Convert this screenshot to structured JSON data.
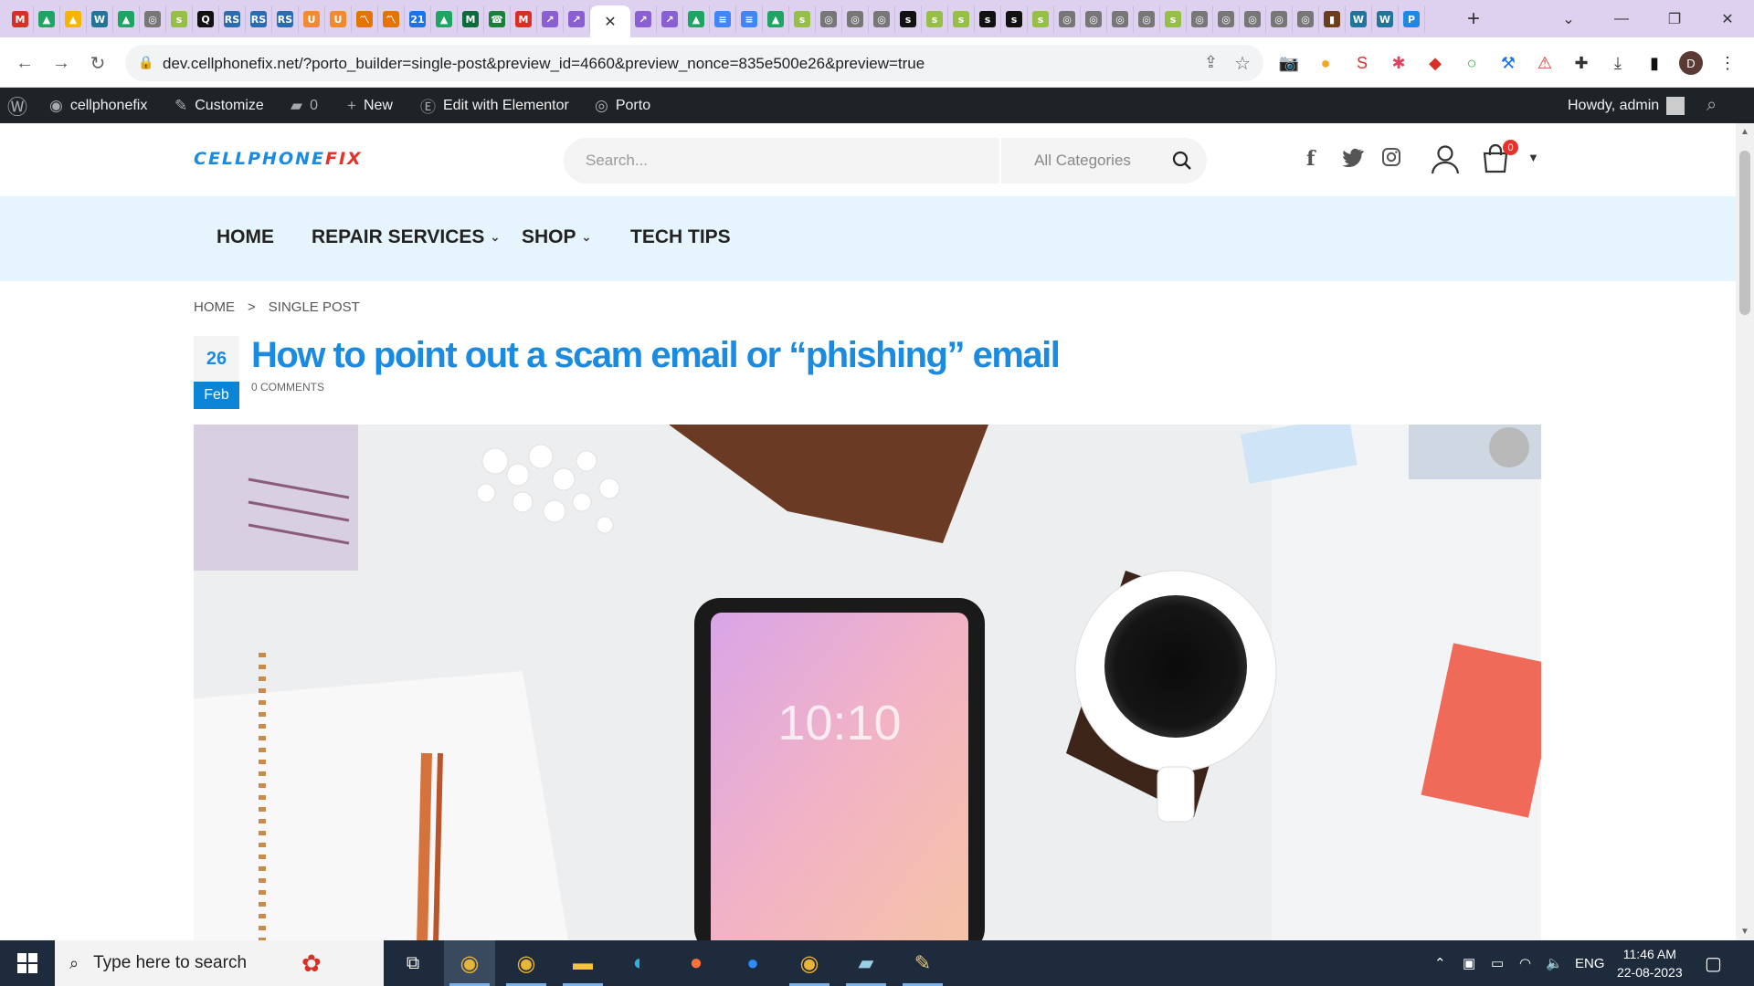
{
  "browser": {
    "tabs_favicons": [
      {
        "icon": "gmail-icon",
        "color": "#d93025",
        "glyph": "M"
      },
      {
        "icon": "drive-icon",
        "color": "#1fa463",
        "glyph": "▲"
      },
      {
        "icon": "drive-icon",
        "color": "#f4b400",
        "glyph": "▲"
      },
      {
        "icon": "wordpress-icon",
        "color": "#21759b",
        "glyph": "W"
      },
      {
        "icon": "drive-icon",
        "color": "#1fa463",
        "glyph": "▲"
      },
      {
        "icon": "globe-icon",
        "color": "#777",
        "glyph": "◎"
      },
      {
        "icon": "shopify-icon",
        "color": "#96bf48",
        "glyph": "s"
      },
      {
        "icon": "quora-icon",
        "color": "#111",
        "glyph": "Q"
      },
      {
        "icon": "rs-icon",
        "color": "#2b6cb0",
        "glyph": "RS"
      },
      {
        "icon": "rs-icon",
        "color": "#2b6cb0",
        "glyph": "RS"
      },
      {
        "icon": "rs-icon",
        "color": "#2b6cb0",
        "glyph": "RS"
      },
      {
        "icon": "u-icon",
        "color": "#f28b30",
        "glyph": "U"
      },
      {
        "icon": "u-icon",
        "color": "#f28b30",
        "glyph": "U"
      },
      {
        "icon": "analytics-icon",
        "color": "#e37400",
        "glyph": "〽"
      },
      {
        "icon": "analytics-icon",
        "color": "#e37400",
        "glyph": "〽"
      },
      {
        "icon": "calendar-icon",
        "color": "#1a73e8",
        "glyph": "21"
      },
      {
        "icon": "drive-icon",
        "color": "#1fa463",
        "glyph": "▲"
      },
      {
        "icon": "m-icon",
        "color": "#0b6b3a",
        "glyph": "M"
      },
      {
        "icon": "phone-icon",
        "color": "#188038",
        "glyph": "☎"
      },
      {
        "icon": "gmail-icon",
        "color": "#d93025",
        "glyph": "M"
      },
      {
        "icon": "chart-icon",
        "color": "#8a5fd1",
        "glyph": "↗"
      },
      {
        "icon": "chart-icon",
        "color": "#8a5fd1",
        "glyph": "↗"
      }
    ],
    "tabs_favicons_after": [
      {
        "icon": "chart-icon",
        "color": "#8a5fd1",
        "glyph": "↗"
      },
      {
        "icon": "chart-icon",
        "color": "#8a5fd1",
        "glyph": "↗"
      },
      {
        "icon": "drive-icon",
        "color": "#1fa463",
        "glyph": "▲"
      },
      {
        "icon": "docs-icon",
        "color": "#4285f4",
        "glyph": "≡"
      },
      {
        "icon": "docs-icon",
        "color": "#4285f4",
        "glyph": "≡"
      },
      {
        "icon": "drive-icon",
        "color": "#1fa463",
        "glyph": "▲"
      },
      {
        "icon": "shopify-icon",
        "color": "#96bf48",
        "glyph": "s"
      },
      {
        "icon": "globe-icon",
        "color": "#777",
        "glyph": "◎"
      },
      {
        "icon": "globe-icon",
        "color": "#777",
        "glyph": "◎"
      },
      {
        "icon": "globe-icon",
        "color": "#777",
        "glyph": "◎"
      },
      {
        "icon": "shopify-icon",
        "color": "#111",
        "glyph": "s"
      },
      {
        "icon": "shopify-icon",
        "color": "#96bf48",
        "glyph": "s"
      },
      {
        "icon": "shopify-icon",
        "color": "#96bf48",
        "glyph": "s"
      },
      {
        "icon": "shopify-icon",
        "color": "#111",
        "glyph": "s"
      },
      {
        "icon": "shopify-icon",
        "color": "#111",
        "glyph": "s"
      },
      {
        "icon": "shopify-icon",
        "color": "#96bf48",
        "glyph": "s"
      },
      {
        "icon": "globe-icon",
        "color": "#777",
        "glyph": "◎"
      },
      {
        "icon": "globe-icon",
        "color": "#777",
        "glyph": "◎"
      },
      {
        "icon": "globe-icon",
        "color": "#777",
        "glyph": "◎"
      },
      {
        "icon": "globe-icon",
        "color": "#777",
        "glyph": "◎"
      },
      {
        "icon": "shopify-icon",
        "color": "#96bf48",
        "glyph": "s"
      },
      {
        "icon": "globe-icon",
        "color": "#777",
        "glyph": "◎"
      },
      {
        "icon": "globe-icon",
        "color": "#777",
        "glyph": "◎"
      },
      {
        "icon": "globe-icon",
        "color": "#777",
        "glyph": "◎"
      },
      {
        "icon": "globe-icon",
        "color": "#777",
        "glyph": "◎"
      },
      {
        "icon": "globe-icon",
        "color": "#777",
        "glyph": "◎"
      },
      {
        "icon": "book-icon",
        "color": "#6b3e1f",
        "glyph": "▮"
      },
      {
        "icon": "wordpress-icon",
        "color": "#21759b",
        "glyph": "W"
      },
      {
        "icon": "wordpress-icon",
        "color": "#21759b",
        "glyph": "W"
      },
      {
        "icon": "p-icon",
        "color": "#1e88e5",
        "glyph": "P"
      }
    ],
    "url": "dev.cellphonefix.net/?porto_builder=single-post&preview_id=4660&preview_nonce=835e500e26&preview=true",
    "profile_initial": "D"
  },
  "adminbar": {
    "site": "cellphonefix",
    "customize": "Customize",
    "comments_count": "0",
    "new": "New",
    "elementor": "Edit with Elementor",
    "porto": "Porto",
    "howdy": "Howdy, admin"
  },
  "header": {
    "logo_part1": "CELLPHONE",
    "logo_part2": "FIX",
    "search_placeholder": "Search...",
    "category": "All Categories",
    "cart_count": "0"
  },
  "nav": {
    "home": "HOME",
    "repair": "REPAIR SERVICES",
    "shop": "SHOP",
    "tips": "TECH TIPS"
  },
  "breadcrumb": {
    "home": "HOME",
    "sep": ">",
    "current": "SINGLE POST"
  },
  "post": {
    "day": "26",
    "month": "Feb",
    "title": "How to point out a scam email or “phishing” email",
    "comments": "0 COMMENTS",
    "hero_clock": "10:10"
  },
  "taskbar": {
    "search_text": "Type here to search",
    "lang": "ENG",
    "time": "11:46 AM",
    "date": "22-08-2023"
  },
  "colors": {
    "brand_blue": "#1a8be0",
    "brand_red": "#e8312a",
    "nav_bg": "#e6f5fd"
  }
}
